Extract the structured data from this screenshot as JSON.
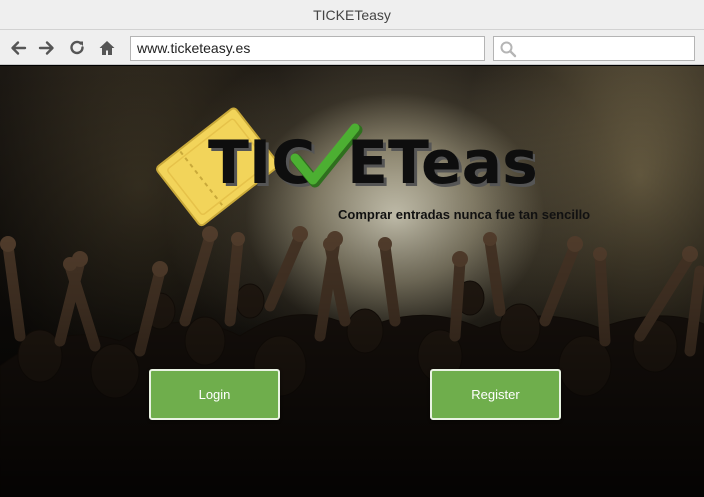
{
  "window": {
    "title": "TICKETeasy"
  },
  "browser": {
    "url": "www.ticketeasy.es",
    "search_placeholder": "",
    "nav_icons": [
      "back-arrow-icon",
      "forward-arrow-icon",
      "reload-icon",
      "home-icon"
    ]
  },
  "logo": {
    "text_left": "TIC",
    "text_right": "ETeasy",
    "check_color": "#4caf32",
    "ticket_color": "#f2d45a"
  },
  "hero": {
    "tagline": "Comprar entradas nunca fue tan sencillo"
  },
  "actions": {
    "login_label": "Login",
    "register_label": "Register",
    "button_color": "#6fae4c"
  }
}
